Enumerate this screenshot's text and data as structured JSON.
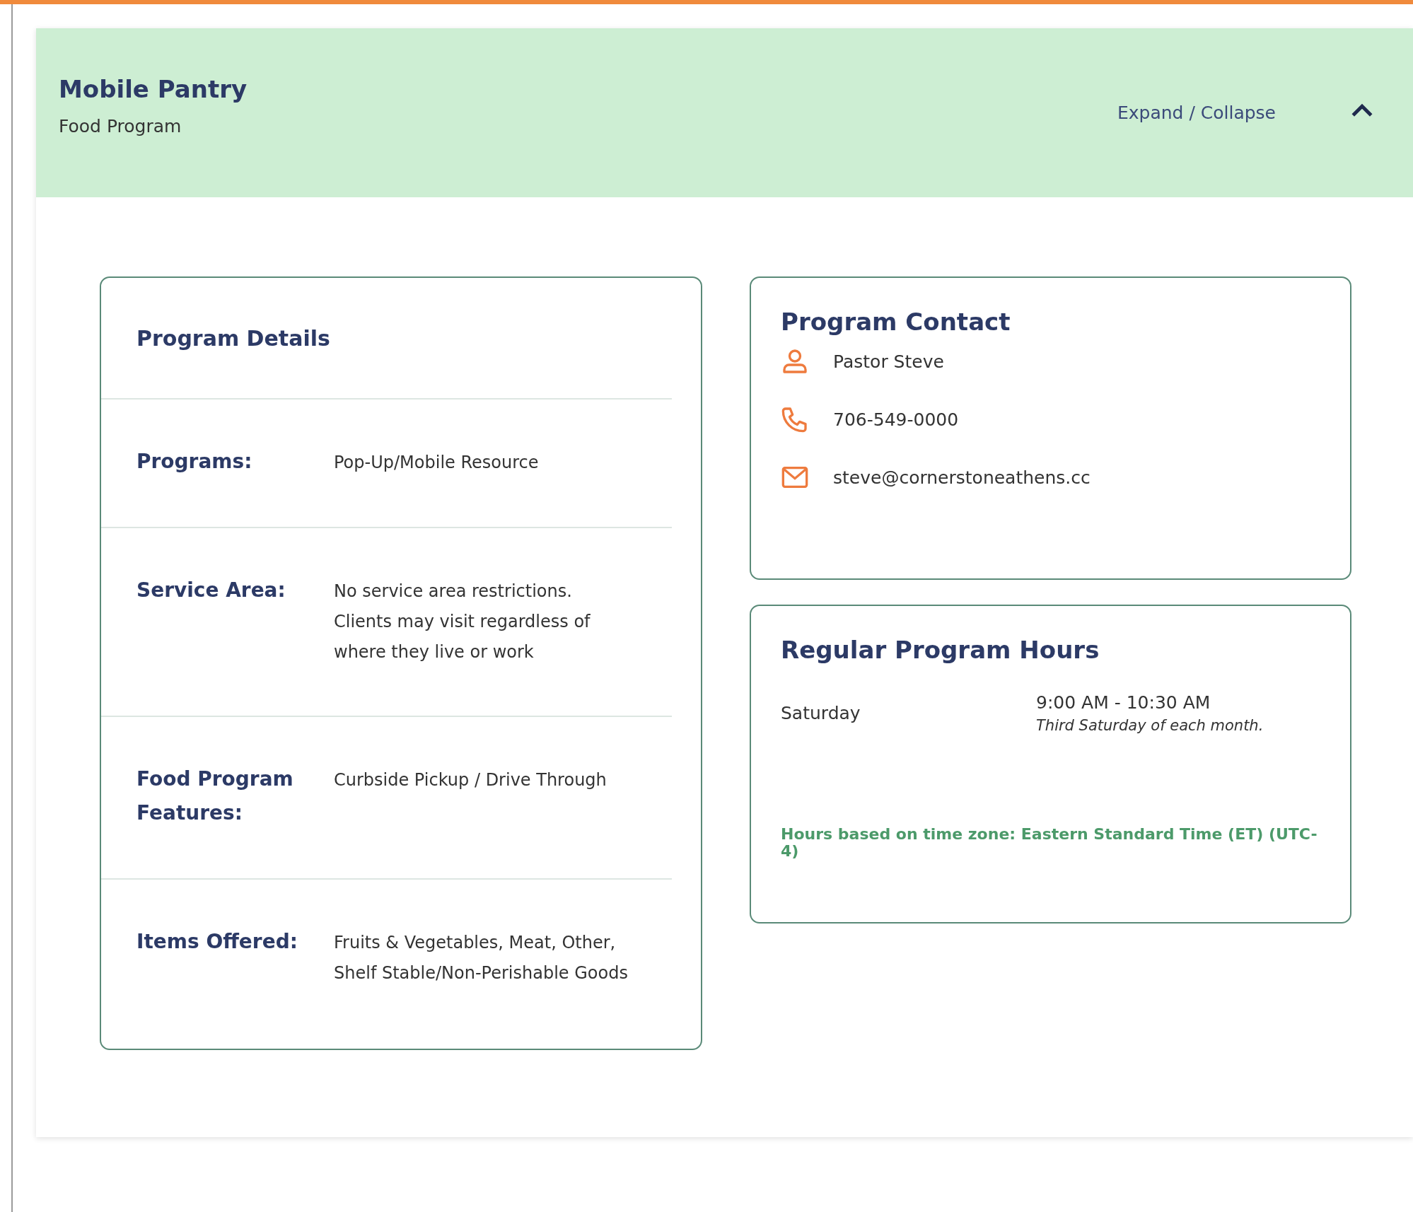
{
  "header": {
    "title": "Mobile Pantry",
    "subtitle": "Food Program",
    "toggle_label": "Expand / Collapse",
    "expanded": true
  },
  "details": {
    "title": "Program Details",
    "rows": [
      {
        "label": "Programs:",
        "value": "Pop-Up/Mobile Resource"
      },
      {
        "label": "Service Area:",
        "value": "No service area restrictions. Clients may visit regardless of where they live or work"
      },
      {
        "label": "Food Program Features:",
        "value": "Curbside Pickup / Drive Through"
      },
      {
        "label": "Items Offered:",
        "value": "Fruits & Vegetables, Meat, Other, Shelf Stable/Non-Perishable Goods"
      }
    ]
  },
  "contact": {
    "title": "Program Contact",
    "items": [
      {
        "kind": "person",
        "text": "Pastor Steve"
      },
      {
        "kind": "phone",
        "text": "706-549-0000"
      },
      {
        "kind": "email",
        "text": "steve@cornerstoneathens.cc"
      }
    ]
  },
  "hours": {
    "title": "Regular Program Hours",
    "schedule": [
      {
        "day": "Saturday",
        "time": "9:00 AM - 10:30 AM",
        "note": "Third Saturday of each month."
      }
    ],
    "timezone_note": "Hours based on time zone: Eastern Standard Time (ET) (UTC-4)"
  }
}
